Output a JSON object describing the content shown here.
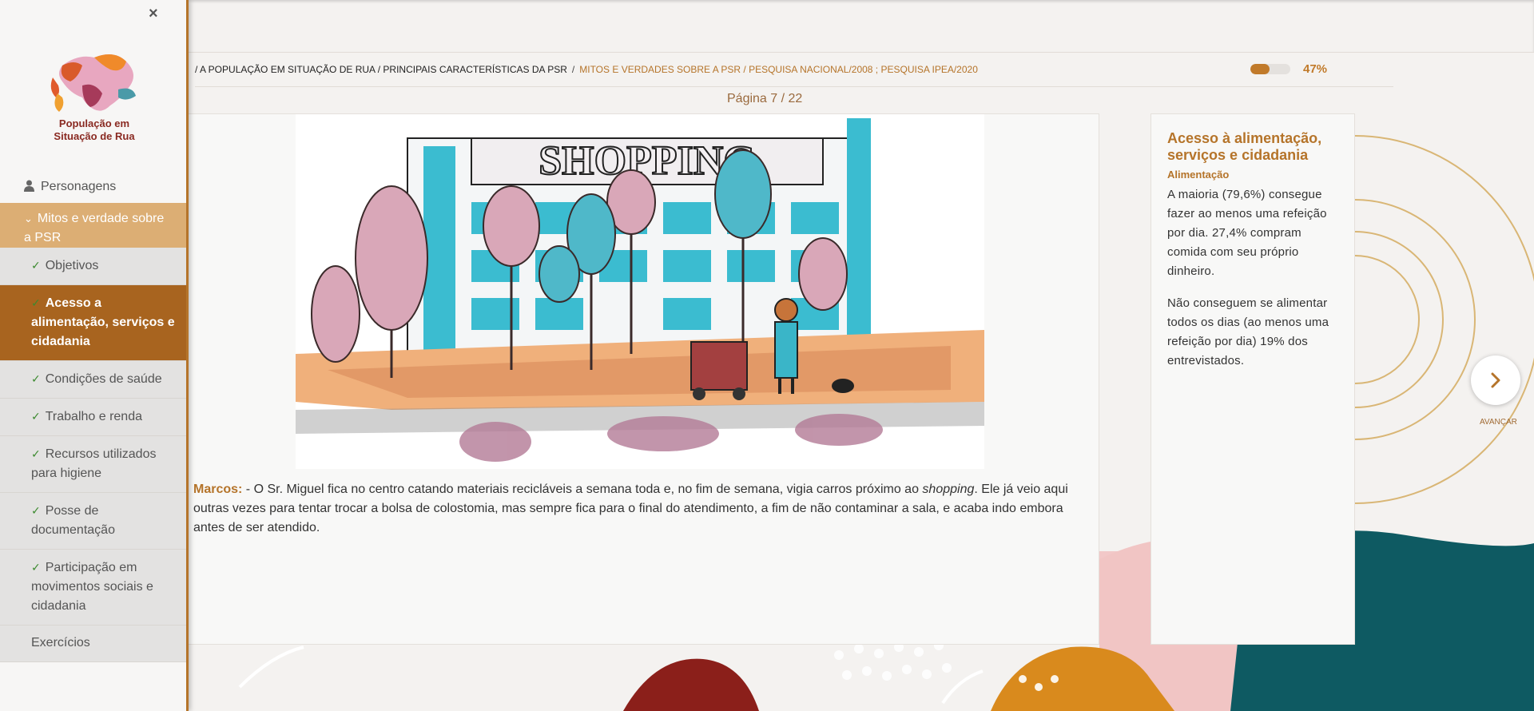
{
  "sidebar": {
    "close_label": "×",
    "logo_line1": "População em",
    "logo_line2": "Situação de Rua",
    "top_item": "Personagens",
    "section_label": "Mitos e verdade sobre a PSR",
    "items": [
      {
        "label": "Objetivos",
        "active": false
      },
      {
        "label": "Acesso a alimentação, serviços e cidadania",
        "active": true
      },
      {
        "label": "Condições de saúde",
        "active": false
      },
      {
        "label": "Trabalho e renda",
        "active": false
      },
      {
        "label": "Recursos utilizados para higiene",
        "active": false
      },
      {
        "label": "Posse de documentação",
        "active": false
      },
      {
        "label": "Participação em movimentos sociais e cidadania",
        "active": false
      }
    ],
    "bottom_item": "Exercícios"
  },
  "breadcrumb": {
    "path": "/ A POPULAÇÃO EM SITUAÇÃO DE RUA / PRINCIPAIS CARACTERÍSTICAS DA PSR",
    "separator": "/",
    "current": "MITOS E VERDADES SOBRE A PSR / PESQUISA NACIONAL/2008 ; PESQUISA IPEA/2020"
  },
  "progress": {
    "value": 0.47,
    "label": "47%"
  },
  "page_indicator": "Página  7 / 22",
  "scene": {
    "sign_text": "SHOPPING"
  },
  "dialogue": {
    "speaker": "Marcos:",
    "text_before": " - O Sr. Miguel fica no centro catando materiais recicláveis a semana toda e, no fim de semana, vigia carros próximo ao ",
    "emphasis": "shopping",
    "text_after": ". Ele já veio aqui outras vezes para tentar trocar a bolsa de colostomia, mas sempre fica para o final do atendimento, a fim de não contaminar a sala, e acaba indo embora antes de ser atendido."
  },
  "info": {
    "title": "Acesso à alimentação, serviços e cidadania",
    "subtitle": "Alimentação",
    "paragraph1": "A maioria (79,6%) consegue fazer ao menos uma refeição por dia. 27,4% compram comida com seu próprio dinheiro.",
    "paragraph2": "Não conseguem se alimentar todos os dias (ao menos uma refeição por dia) 19% dos entrevistados."
  },
  "next": {
    "label": "AVANÇAR"
  },
  "colors": {
    "accent": "#b5742a",
    "active_bg": "#a8641f",
    "section_bg": "#dcae74",
    "check": "#3c8a2f"
  }
}
